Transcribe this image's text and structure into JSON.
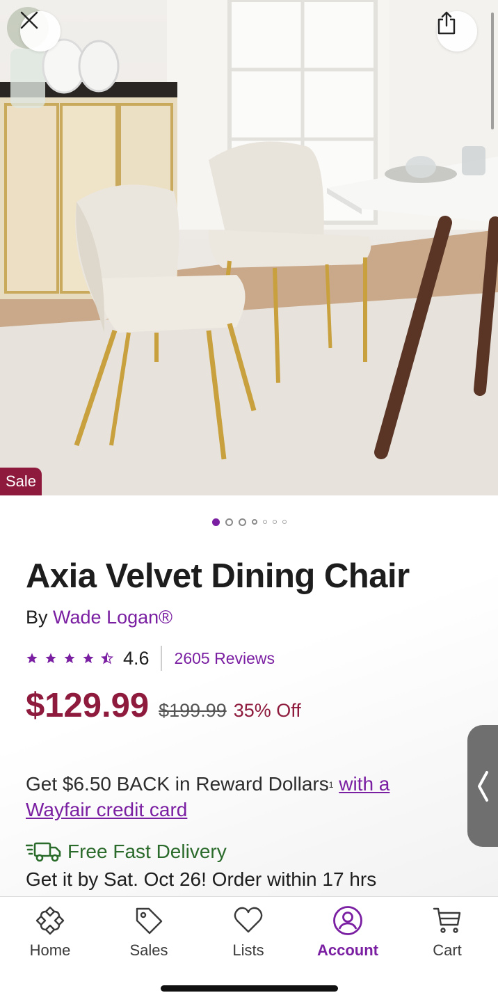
{
  "hero": {
    "close_icon": "close-icon",
    "share_icon": "share-icon",
    "sale_badge": "Sale",
    "image_count": 7,
    "active_image": 1
  },
  "product": {
    "title": "Axia Velvet Dining Chair",
    "by_label": "By",
    "brand": "Wade Logan®",
    "rating": {
      "value": "4.6",
      "stars": 4.5,
      "reviews_label": "2605 Reviews"
    },
    "price": {
      "sale": "$129.99",
      "original": "$199.99",
      "discount": "35% Off"
    },
    "reward": {
      "text": "Get $6.50 BACK in Reward Dollars",
      "footnote": "1",
      "link_line1": "with a",
      "link_line2": "Wayfair credit card"
    },
    "delivery": {
      "icon": "fast-delivery-truck-icon",
      "label": "Free Fast Delivery",
      "date_text": "Get it by Sat. Oct 26! Order within 17 hrs"
    }
  },
  "side_tab": {
    "icon": "chevron-left-icon"
  },
  "bottom_nav": {
    "items": [
      {
        "label": "Home",
        "icon": "home-icon"
      },
      {
        "label": "Sales",
        "icon": "tag-icon"
      },
      {
        "label": "Lists",
        "icon": "heart-icon"
      },
      {
        "label": "Account",
        "icon": "account-icon",
        "active": true
      },
      {
        "label": "Cart",
        "icon": "cart-icon"
      }
    ]
  },
  "colors": {
    "accent": "#7a1fa2",
    "sale": "#8e1b3d",
    "delivery": "#2a6a2a"
  }
}
